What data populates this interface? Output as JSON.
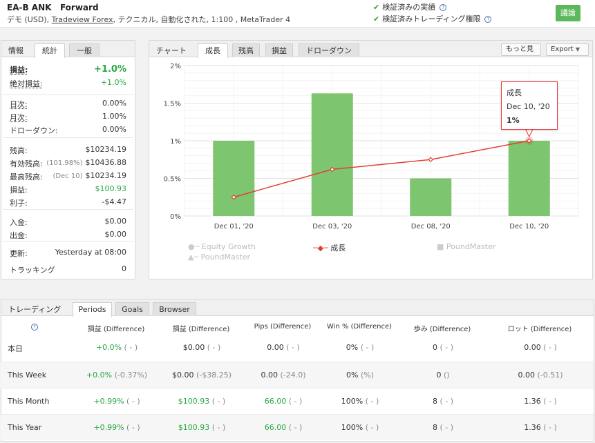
{
  "header": {
    "name": "EA-B ANK",
    "mode": "Forward",
    "meta_prefix": "デモ (USD), ",
    "broker": "Tradeview Forex",
    "meta_suffix": ", テクニカル, 自動化された, 1:100 , MetaTrader 4",
    "verified_1": "検証済みの実績",
    "verified_2": "検証済みトレーディング権限",
    "discuss": "議論"
  },
  "stats": {
    "tabs": [
      "情報",
      "統計",
      "一般"
    ],
    "rows": [
      {
        "k": "損益:",
        "v": "+1.0%",
        "green": true,
        "bold": true
      },
      {
        "k": "絶対損益:",
        "v": "+1.0%",
        "green": true
      },
      {
        "k": "日次:",
        "v": "0.00%"
      },
      {
        "k": "月次:",
        "v": "1.00%"
      },
      {
        "k": "ドローダウン:",
        "v": "0.00%"
      },
      {
        "k": "残高:",
        "v": "$10234.19"
      },
      {
        "k": "有効残高:",
        "note": "(101.98%)",
        "v": "$10436.88"
      },
      {
        "k": "最高残高:",
        "note": "(Dec 10)",
        "v": "$10234.19"
      },
      {
        "k": "損益:",
        "v": "$100.93",
        "green": true
      },
      {
        "k": "利子:",
        "v": "-$4.47"
      },
      {
        "k": "入金:",
        "v": "$0.00"
      },
      {
        "k": "出金:",
        "v": "$0.00"
      },
      {
        "k": "更新:",
        "v": "Yesterday at 08:00"
      },
      {
        "k": "トラッキング",
        "v": "0"
      }
    ]
  },
  "chart_panel": {
    "label": "チャート",
    "tabs": [
      "成長",
      "残高",
      "損益",
      "ドローダウン"
    ],
    "more_btn": "もっと見",
    "export_btn": "Export"
  },
  "chart_data": {
    "type": "bar",
    "categories": [
      "Dec 01, '20",
      "Dec 03, '20",
      "Dec 08, '20",
      "Dec 10, '20"
    ],
    "series": [
      {
        "name": "成長",
        "type": "bar",
        "values": [
          1.0,
          1.63,
          0.5,
          1.0
        ],
        "color": "#7dc56f"
      },
      {
        "name": "成長",
        "type": "line",
        "values": [
          0.25,
          0.62,
          0.75,
          1.0
        ],
        "color": "#e04033"
      }
    ],
    "ylim": [
      0,
      2
    ],
    "yticks": [
      "0%",
      "0.5%",
      "1%",
      "1.5%",
      "2%"
    ],
    "ytick_values": [
      0,
      0.5,
      1,
      1.5,
      2
    ],
    "legend": [
      "Equity Growth",
      "成長",
      "PoundMaster",
      "PoundMaster"
    ],
    "tooltip": {
      "title": "成長",
      "date": "Dec 10, '20",
      "value": "1%"
    }
  },
  "trading": {
    "label": "トレーディング",
    "tabs": [
      "Periods",
      "Goals",
      "Browser"
    ],
    "help": "?",
    "columns": [
      "損益 (Difference)",
      "損益 (Difference)",
      "Pips (Difference)",
      "Win % (Difference)",
      "歩み (Difference)",
      "ロット (Difference)"
    ],
    "rows": [
      {
        "label": "本日",
        "cells": [
          [
            "+0.0%",
            " ( - )",
            true
          ],
          [
            "$0.00",
            " ( - )",
            false
          ],
          [
            "0.00",
            " ( - )",
            false
          ],
          [
            "0%",
            " ( - )",
            false
          ],
          [
            "0",
            " ( - )",
            false
          ],
          [
            "0.00",
            " ( - )",
            false
          ]
        ]
      },
      {
        "label": "This Week",
        "cells": [
          [
            "+0.0%",
            " (-0.37%)",
            true
          ],
          [
            "$0.00",
            " (-$38.25)",
            false
          ],
          [
            "0.00",
            " (-24.0)",
            false
          ],
          [
            "0%",
            " (%)",
            false
          ],
          [
            "0",
            " ()",
            false
          ],
          [
            "0.00",
            " (-0.51)",
            false
          ]
        ]
      },
      {
        "label": "This Month",
        "cells": [
          [
            "+0.99%",
            " ( - )",
            true
          ],
          [
            "$100.93",
            " ( - )",
            true
          ],
          [
            "66.00",
            " ( - )",
            true
          ],
          [
            "100%",
            " ( - )",
            false
          ],
          [
            "8",
            " ( - )",
            false
          ],
          [
            "1.36",
            " ( - )",
            false
          ]
        ]
      },
      {
        "label": "This Year",
        "cells": [
          [
            "+0.99%",
            " ( - )",
            true
          ],
          [
            "$100.93",
            " ( - )",
            true
          ],
          [
            "66.00",
            " ( - )",
            true
          ],
          [
            "100%",
            " ( - )",
            false
          ],
          [
            "8",
            " ( - )",
            false
          ],
          [
            "1.36",
            " ( - )",
            false
          ]
        ]
      }
    ]
  }
}
